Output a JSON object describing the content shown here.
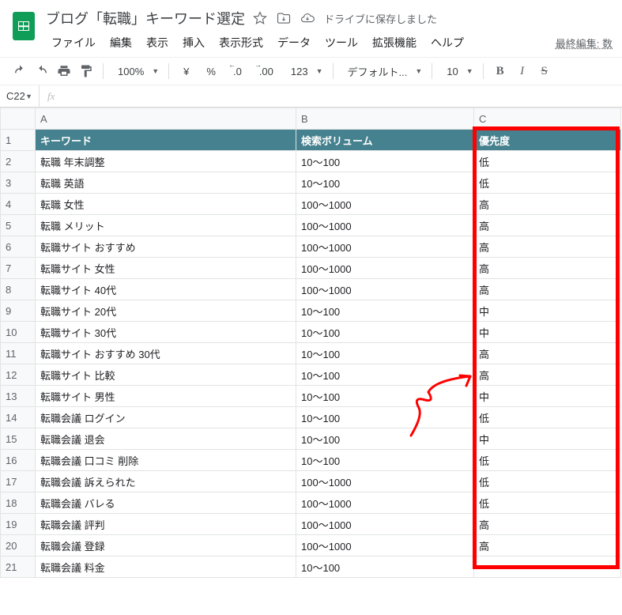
{
  "header": {
    "title": "ブログ「転職」キーワード選定",
    "save_status": "ドライブに保存しました",
    "last_edit": "最終編集: 数"
  },
  "menu": [
    "ファイル",
    "編集",
    "表示",
    "挿入",
    "表示形式",
    "データ",
    "ツール",
    "拡張機能",
    "ヘルプ"
  ],
  "toolbar": {
    "zoom": "100%",
    "currency": "¥",
    "percent": "%",
    "dec_dec": ".0",
    "dec_inc": ".00",
    "num_fmt": "123",
    "font": "デフォルト...",
    "font_size": "10",
    "bold": "B",
    "italic": "I",
    "strike": "S"
  },
  "formula": {
    "cell_ref": "C22",
    "fx": "fx",
    "value": ""
  },
  "columns": [
    "A",
    "B",
    "C"
  ],
  "table_headers": {
    "A": "キーワード",
    "B": "検索ボリューム",
    "C": "優先度"
  },
  "rows": [
    {
      "n": 1,
      "A": "キーワード",
      "B": "検索ボリューム",
      "C": "優先度",
      "hdr": true
    },
    {
      "n": 2,
      "A": "転職 年末調整",
      "B": "10～100",
      "C": "低"
    },
    {
      "n": 3,
      "A": "転職 英語",
      "B": "10～100",
      "C": "低"
    },
    {
      "n": 4,
      "A": "転職 女性",
      "B": "100～1000",
      "C": "高"
    },
    {
      "n": 5,
      "A": "転職 メリット",
      "B": "100～1000",
      "C": "高"
    },
    {
      "n": 6,
      "A": "転職サイト おすすめ",
      "B": "100～1000",
      "C": "高"
    },
    {
      "n": 7,
      "A": "転職サイト 女性",
      "B": "100～1000",
      "C": "高"
    },
    {
      "n": 8,
      "A": "転職サイト 40代",
      "B": "100～1000",
      "C": "高"
    },
    {
      "n": 9,
      "A": "転職サイト 20代",
      "B": "10～100",
      "C": "中"
    },
    {
      "n": 10,
      "A": "転職サイト 30代",
      "B": "10～100",
      "C": "中"
    },
    {
      "n": 11,
      "A": "転職サイト おすすめ 30代",
      "B": "10～100",
      "C": "高"
    },
    {
      "n": 12,
      "A": "転職サイト 比較",
      "B": "10～100",
      "C": "高"
    },
    {
      "n": 13,
      "A": "転職サイト 男性",
      "B": "10～100",
      "C": "中"
    },
    {
      "n": 14,
      "A": "転職会議 ログイン",
      "B": "10～100",
      "C": "低"
    },
    {
      "n": 15,
      "A": "転職会議 退会",
      "B": "10～100",
      "C": "中"
    },
    {
      "n": 16,
      "A": "転職会議 口コミ 削除",
      "B": "10～100",
      "C": "低"
    },
    {
      "n": 17,
      "A": "転職会議 訴えられた",
      "B": "100～1000",
      "C": "低"
    },
    {
      "n": 18,
      "A": "転職会議 バレる",
      "B": "100～1000",
      "C": "低"
    },
    {
      "n": 19,
      "A": "転職会議 評判",
      "B": "100～1000",
      "C": "高"
    },
    {
      "n": 20,
      "A": "転職会議 登録",
      "B": "100～1000",
      "C": "高"
    },
    {
      "n": 21,
      "A": "転職会議 料金",
      "B": "10～100",
      "C": ""
    }
  ]
}
